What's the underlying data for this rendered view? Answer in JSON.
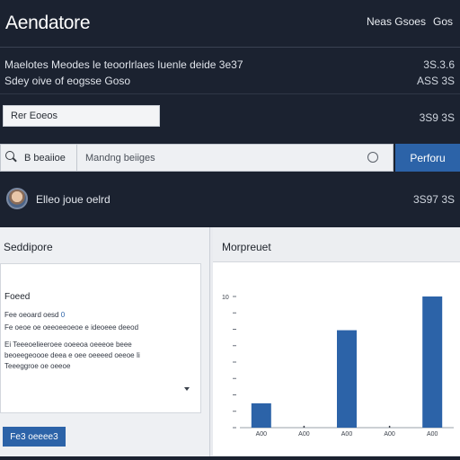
{
  "header": {
    "title": "Aendatore",
    "links": [
      "Neas Gsoes",
      "Gos"
    ]
  },
  "info": {
    "line1": "Maelotes Meodes le teoorlrlaes Iuenle deide 3e37",
    "line2": "Sdey oive of eogsse Goso",
    "right1": "3S.3.6",
    "right2": "ASS 3S"
  },
  "filter": {
    "value": "Rer Eoeos",
    "right": "3S9 3S"
  },
  "search": {
    "scope": "B beaiioe",
    "placeholder": "Mandng beiiges",
    "button": "Perforu"
  },
  "user": {
    "name": "Elleo joue oelrd",
    "right": "3S97 3S"
  },
  "left_panel": {
    "header": "Seddipore",
    "card_title": "Foeed",
    "line1_a": "Fee oeoard oesd",
    "line1_b": "0",
    "line2": "Fe oeoe oe oeeoeeoeoe e ideoeee deeod",
    "line3": "Ei   Teeeoelieeroee ooeeoa oeeeoe beee",
    "line4": "beoeegeoooe deea e oee oeeeed oeeoe Ii",
    "line5": "Teeeggroe oe oeeoe",
    "button": "Fe3 oeeee3"
  },
  "right_panel": {
    "header": "Morpreuet"
  },
  "chart_data": {
    "type": "bar",
    "categories": [
      "A00",
      "A00",
      "A00",
      "A00",
      "A00"
    ],
    "values": [
      13,
      1,
      52,
      1,
      70
    ],
    "ylim": [
      0,
      70
    ],
    "ytick_labels": [
      "10",
      "",
      "",
      "",
      "",
      "",
      "",
      "",
      ""
    ],
    "bar_color": "#2c63a8"
  }
}
